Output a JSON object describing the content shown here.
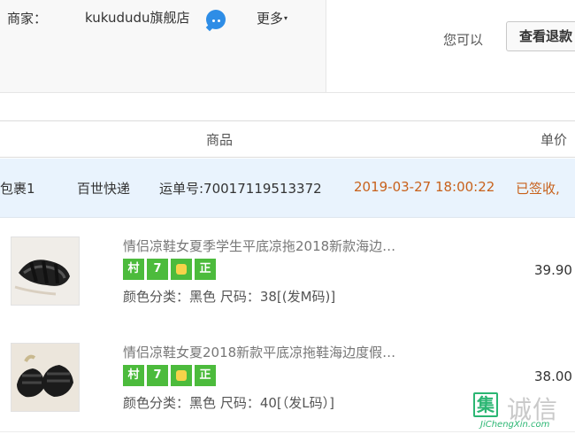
{
  "merchant": {
    "label": "商家：",
    "store_name": "kukududu旗舰店",
    "more_label": "更多",
    "more_caret": "▾"
  },
  "actions": {
    "hint": "您可以",
    "refund_button": "查看退款"
  },
  "table": {
    "col_goods": "商品",
    "col_price": "单价"
  },
  "package": {
    "label": "包裹1",
    "carrier": "百世快递",
    "waybill": "运单号:70017119513372",
    "time": "2019-03-27 18:00:22",
    "status": "已签收,"
  },
  "items": [
    {
      "title": "情侣凉鞋女夏季学生平底凉拖2018新款海边…",
      "badges": [
        "村",
        "7",
        "",
        "正"
      ],
      "attr_color_label": "颜色分类：",
      "attr_color_value": "黑色",
      "attr_size_label": "尺码：",
      "attr_size_value": "38[(发M码)]",
      "price": "39.90"
    },
    {
      "title": "情侣凉鞋女夏2018新款平底凉拖鞋海边度假…",
      "badges": [
        "村",
        "7",
        "",
        "正"
      ],
      "attr_color_label": "颜色分类：",
      "attr_color_value": "黑色",
      "attr_size_label": "尺码：",
      "attr_size_value": "40[（发L码）]",
      "price": "38.00"
    }
  ],
  "watermark": {
    "box_char": "集",
    "text": "诚信",
    "url": "JiChengXin.com"
  },
  "colors": {
    "accent_orange": "#c8611b",
    "package_bg": "#e9f3fd",
    "badge_green": "#4cbb3c",
    "wangwang_blue": "#2e8de6"
  }
}
